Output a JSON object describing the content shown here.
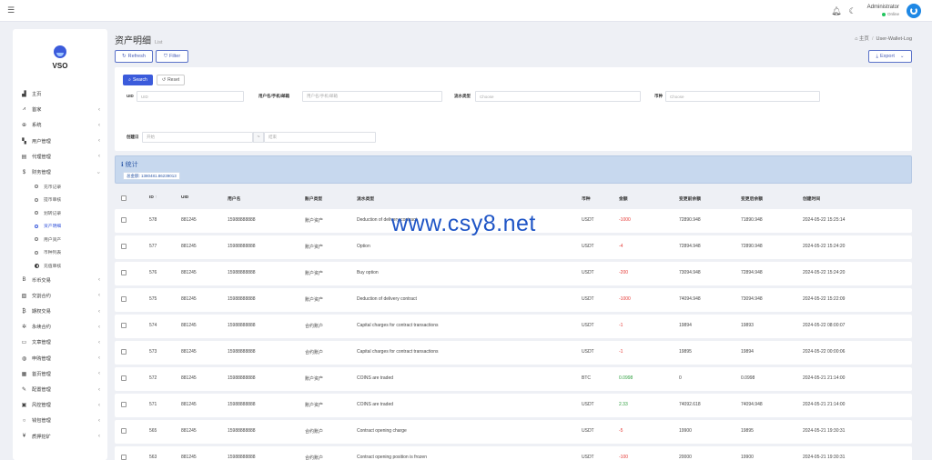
{
  "topbar": {
    "menu_icon": "bars-icon",
    "admin_name": "Administrator",
    "admin_status": "Online",
    "colors": {
      "online": "#22c55e",
      "avatar": "#1e88e5"
    }
  },
  "sidebar": {
    "logo_text": "VSO",
    "menu": [
      {
        "label": "主页",
        "icon": "chart-bar-icon",
        "glyph": "▟",
        "chevron": false
      },
      {
        "label": "首家",
        "icon": "trend-icon",
        "glyph": "⩘",
        "chevron": true
      },
      {
        "label": "系统",
        "icon": "circle-plus-icon",
        "glyph": "⊕",
        "chevron": true
      },
      {
        "label": "用户管理",
        "icon": "user-icon",
        "glyph": "▚",
        "chevron": true
      },
      {
        "label": "代理管理",
        "icon": "id-card-icon",
        "glyph": "▤",
        "chevron": true
      },
      {
        "label": "财务管理",
        "icon": "dollar-icon",
        "glyph": "$",
        "chevron": true,
        "open": true
      }
    ],
    "submenu": [
      {
        "label": "充币记录",
        "active": false
      },
      {
        "label": "提币审核",
        "active": false
      },
      {
        "label": "划转记录",
        "active": false
      },
      {
        "label": "资产明细",
        "active": true
      },
      {
        "label": "用户资产",
        "active": false
      },
      {
        "label": "币种列表",
        "active": false
      },
      {
        "label": "充值审核",
        "active": false,
        "half": true
      }
    ],
    "menu_after": [
      {
        "label": "币币交易",
        "icon": "bitcoin-icon",
        "glyph": "B",
        "chevron": true
      },
      {
        "label": "交割合约",
        "icon": "layers-icon",
        "glyph": "▧",
        "chevron": true
      },
      {
        "label": "期权交易",
        "icon": "bitcoin-icon",
        "glyph": "₿",
        "chevron": true
      },
      {
        "label": "永续合约",
        "icon": "gear-icon",
        "glyph": "✲",
        "chevron": true
      },
      {
        "label": "文章管理",
        "icon": "keyboard-icon",
        "glyph": "▭",
        "chevron": true
      },
      {
        "label": "申购管理",
        "icon": "globe-icon",
        "glyph": "◍",
        "chevron": true
      },
      {
        "label": "首页管理",
        "icon": "table-icon",
        "glyph": "▦",
        "chevron": true
      },
      {
        "label": "配置管理",
        "icon": "wrench-icon",
        "glyph": "✎",
        "chevron": true
      },
      {
        "label": "风控管理",
        "icon": "sliders-icon",
        "glyph": "▣",
        "chevron": true
      },
      {
        "label": "钱包管理",
        "icon": "circle-icon",
        "glyph": "○",
        "chevron": true
      },
      {
        "label": "质押挖矿",
        "icon": "yen-icon",
        "glyph": "¥",
        "chevron": true
      }
    ]
  },
  "header": {
    "title": "资产明细",
    "subtitle": "List",
    "breadcrumb": [
      "主页",
      "User-Wallet-Log"
    ]
  },
  "toolbar": {
    "refresh_label": "Refresh",
    "filter_label": "Filter",
    "export_label": "Export"
  },
  "search": {
    "search_label": "Search",
    "reset_label": "Reset",
    "fields": {
      "uid_label": "UID",
      "uid_placeholder": "UID",
      "user_label": "用户名/手机/邮箱",
      "user_placeholder": "用户名/手机/邮箱",
      "type_label": "流水类型",
      "type_placeholder": "Choose",
      "coin_label": "币种",
      "coin_placeholder": "Choose",
      "time_label": "创建日",
      "time_start_placeholder": "开始",
      "time_sep": "~",
      "time_end_placeholder": "结束"
    }
  },
  "stats": {
    "title": "统计",
    "chip": "总金额: 1380481.86239013"
  },
  "table": {
    "columns": [
      "ID",
      "UID",
      "用户名",
      "账户类型",
      "流水类型",
      "币种",
      "金额",
      "变更前余额",
      "变更后余额",
      "创建时间"
    ],
    "sort_glyph": "↑",
    "rows": [
      {
        "id": "578",
        "uid": "881245",
        "user": "15988888888",
        "acct": "账户资产",
        "type": "Deduction of delivery contract",
        "coin": "USDT",
        "amount": "-1000",
        "sign": "neg",
        "before": "72890.948",
        "after": "71890.948",
        "time": "2024-05-22 15:25:14"
      },
      {
        "id": "577",
        "uid": "881245",
        "user": "15988888888",
        "acct": "账户资产",
        "type": "Option",
        "coin": "USDT",
        "amount": "-4",
        "sign": "neg",
        "before": "72894.948",
        "after": "72890.948",
        "time": "2024-05-22 15:24:20"
      },
      {
        "id": "576",
        "uid": "881245",
        "user": "15988888888",
        "acct": "账户资产",
        "type": "Buy option",
        "coin": "USDT",
        "amount": "-200",
        "sign": "neg",
        "before": "73094.948",
        "after": "72894.948",
        "time": "2024-05-22 15:24:20"
      },
      {
        "id": "575",
        "uid": "881245",
        "user": "15988888888",
        "acct": "账户资产",
        "type": "Deduction of delivery contract",
        "coin": "USDT",
        "amount": "-1000",
        "sign": "neg",
        "before": "74094.948",
        "after": "73094.948",
        "time": "2024-05-22 15:22:09"
      },
      {
        "id": "574",
        "uid": "881245",
        "user": "15988888888",
        "acct": "合约账户",
        "type": "Capital charges for contract transactions",
        "coin": "USDT",
        "amount": "-1",
        "sign": "neg",
        "before": "19894",
        "after": "19893",
        "time": "2024-05-22 08:00:07"
      },
      {
        "id": "573",
        "uid": "881245",
        "user": "15988888888",
        "acct": "合约账户",
        "type": "Capital charges for contract transactions",
        "coin": "USDT",
        "amount": "-1",
        "sign": "neg",
        "before": "19895",
        "after": "19894",
        "time": "2024-05-22 00:00:06"
      },
      {
        "id": "572",
        "uid": "881245",
        "user": "15988888888",
        "acct": "账户资产",
        "type": "COINS are traded",
        "coin": "BTC",
        "amount": "0.0998",
        "sign": "pos",
        "before": "0",
        "after": "0.0998",
        "time": "2024-05-21 21:14:00"
      },
      {
        "id": "571",
        "uid": "881245",
        "user": "15988888888",
        "acct": "账户资产",
        "type": "COINS are traded",
        "coin": "USDT",
        "amount": "2.33",
        "sign": "pos",
        "before": "74092.618",
        "after": "74094.948",
        "time": "2024-05-21 21:14:00"
      },
      {
        "id": "565",
        "uid": "881245",
        "user": "15988888888",
        "acct": "合约账户",
        "type": "Contract opening charge",
        "coin": "USDT",
        "amount": "-5",
        "sign": "neg",
        "before": "19900",
        "after": "19895",
        "time": "2024-05-21 19:30:31"
      },
      {
        "id": "563",
        "uid": "881245",
        "user": "15988888888",
        "acct": "合约账户",
        "type": "Contract opening position is frozen",
        "coin": "USDT",
        "amount": "-100",
        "sign": "neg",
        "before": "20000",
        "after": "19900",
        "time": "2024-05-21 19:30:31"
      }
    ]
  },
  "watermark": "www.csy8.net",
  "colors": {
    "primary": "#3b5bdb",
    "negative": "#e53935",
    "positive": "#2e9e3e",
    "stats_bg": "#c7d8ee"
  }
}
